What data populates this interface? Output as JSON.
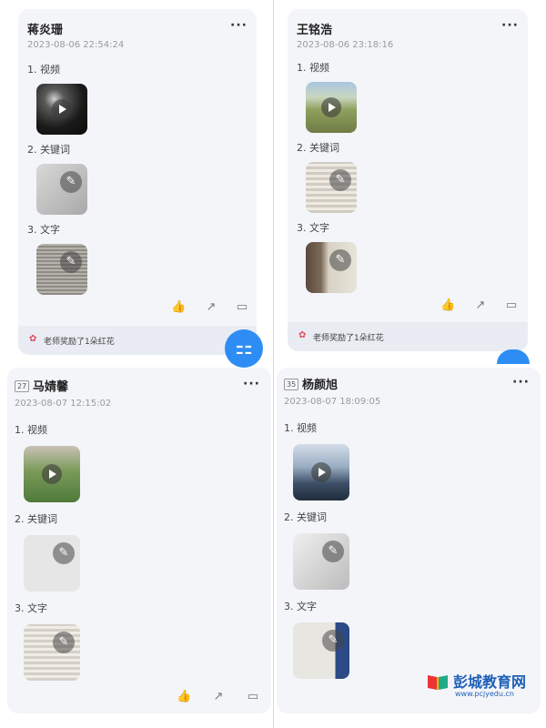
{
  "cards": [
    {
      "name": "蒋炎珊",
      "badge": "",
      "time": "2023-08-06 22:54:24",
      "more": "···",
      "sections": [
        "1. 视频",
        "2. 关键词",
        "3. 文字"
      ],
      "reward": "老师奖励了1朵红花"
    },
    {
      "name": "王铭浩",
      "badge": "",
      "time": "2023-08-06 23:18:16",
      "more": "···",
      "sections": [
        "1. 视频",
        "2. 关键词",
        "3. 文字"
      ],
      "reward": "老师奖励了1朵红花"
    },
    {
      "name": "马婧馨",
      "badge": "27",
      "time": "2023-08-07 12:15:02",
      "more": "···",
      "sections": [
        "1. 视频",
        "2. 关键词",
        "3. 文字"
      ]
    },
    {
      "name": "杨颜旭",
      "badge": "35",
      "time": "2023-08-07 18:09:05",
      "more": "···",
      "sections": [
        "1. 视频",
        "2. 关键词",
        "3. 文字"
      ]
    }
  ],
  "icons": {
    "like": "thumbs-up-icon",
    "share": "share-icon",
    "comment": "comment-icon",
    "edit": "pencil-icon",
    "play": "play-icon",
    "flower": "flower-icon",
    "fab": "grid-menu-icon"
  },
  "colors": {
    "accent": "#2e8df5",
    "flower": "#e04a5a",
    "card_bg": "#f3f5f9"
  },
  "watermark": {
    "title": "彭城教育网",
    "url": "www.pcjyedu.cn"
  }
}
